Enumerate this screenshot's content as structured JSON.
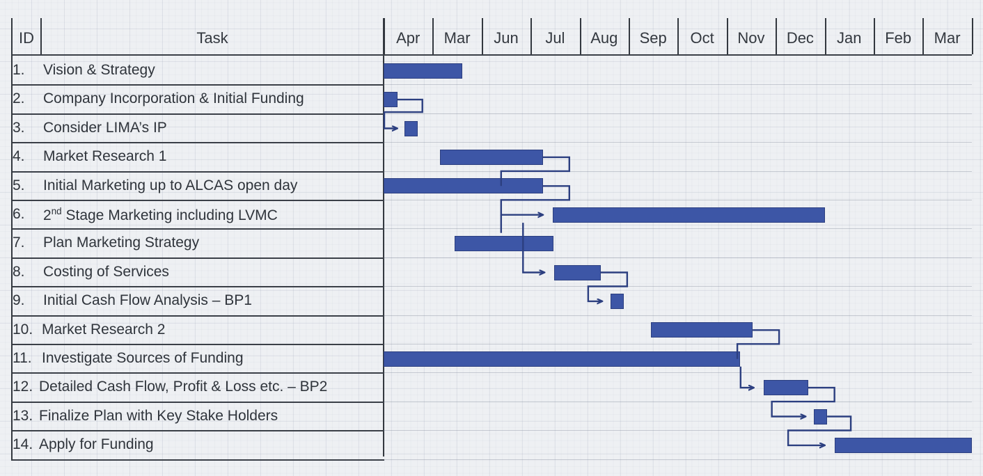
{
  "chart_data": {
    "type": "gantt",
    "title": "",
    "columns": [
      "ID",
      "Task"
    ],
    "timeline_labels": [
      "Apr",
      "Mar",
      "Jun",
      "Jul",
      "Aug",
      "Sep",
      "Oct",
      "Nov",
      "Dec",
      "Jan",
      "Feb",
      "Mar"
    ],
    "accent_color": "#3d56a6",
    "grid": true,
    "legend": "none",
    "xlabel": "",
    "ylabel": "",
    "tasks": [
      {
        "id": "1.",
        "label": "Vision & Strategy",
        "start_month": 0.0,
        "end_month": 1.6
      },
      {
        "id": "2.",
        "label": "Company Incorporation & Initial Funding",
        "start_month": 0.0,
        "end_month": 0.28
      },
      {
        "id": "3.",
        "label": "Consider LIMA’s IP",
        "start_month": 0.42,
        "end_month": 0.7
      },
      {
        "id": "4.",
        "label": "Market Research 1",
        "start_month": 1.15,
        "end_month": 3.25
      },
      {
        "id": "5.",
        "label": "Initial Marketing up to ALCAS open day",
        "start_month": 0.0,
        "end_month": 3.25
      },
      {
        "id": "6.",
        "label": "2nd Stage Marketing including LVMC",
        "start_month": 3.45,
        "end_month": 9.0,
        "superscript": "nd",
        "prefix": "2",
        "suffix": " Stage Marketing including LVMC"
      },
      {
        "id": "7.",
        "label": "Plan Marketing Strategy",
        "start_month": 1.45,
        "end_month": 3.47
      },
      {
        "id": "8.",
        "label": "Costing of Services",
        "start_month": 3.48,
        "end_month": 4.43
      },
      {
        "id": "9.",
        "label": "Initial Cash Flow Analysis – BP1",
        "start_month": 4.63,
        "end_month": 4.9
      },
      {
        "id": "10.",
        "label": "Market Research 2",
        "start_month": 5.45,
        "end_month": 7.53
      },
      {
        "id": "11.",
        "label": "Investigate Sources of Funding",
        "start_month": 0.0,
        "end_month": 7.27
      },
      {
        "id": "12.",
        "label": "Detailed Cash Flow, Profit & Loss etc. – BP2",
        "start_month": 7.75,
        "end_month": 8.66
      },
      {
        "id": "13.",
        "label": "Finalize Plan with Key Stake Holders",
        "start_month": 8.78,
        "end_month": 9.05
      },
      {
        "id": "14.",
        "label": "Apply for Funding",
        "start_month": 9.2,
        "end_month": 12.0
      }
    ]
  }
}
